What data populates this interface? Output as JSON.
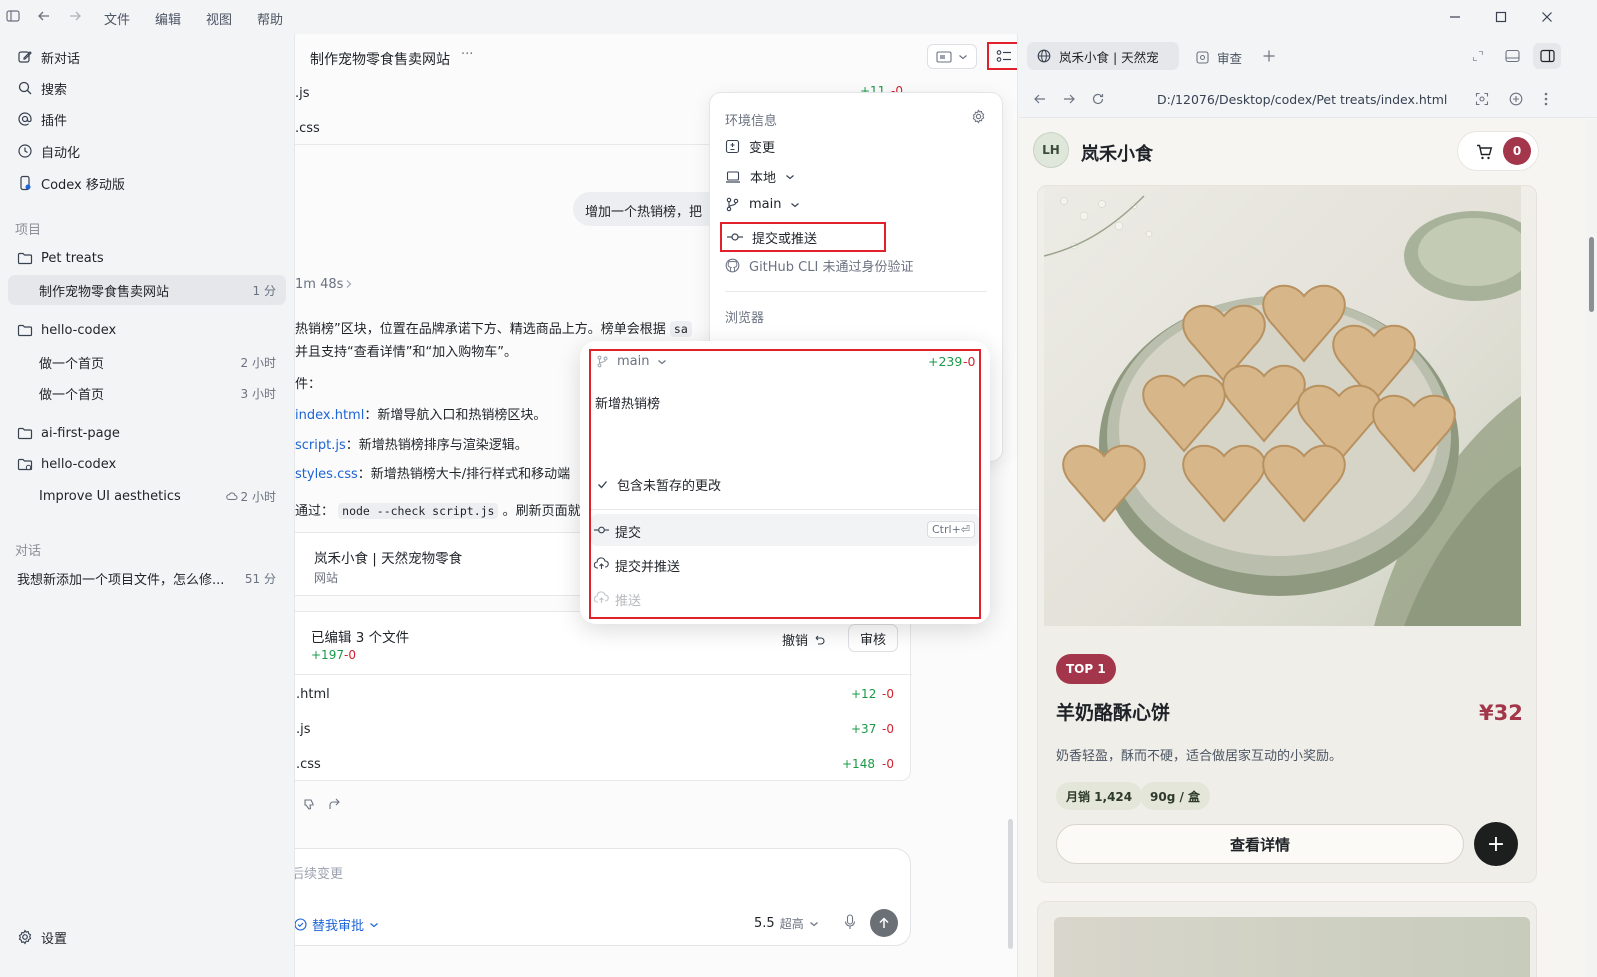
{
  "menu": [
    "文件",
    "编辑",
    "视图",
    "帮助"
  ],
  "sidebar": {
    "top_items": [
      {
        "label": "新对话",
        "icon": "edit-icon"
      },
      {
        "label": "搜索",
        "icon": "search-icon"
      },
      {
        "label": "插件",
        "icon": "at-icon"
      },
      {
        "label": "自动化",
        "icon": "clock-icon"
      },
      {
        "label": "Codex 移动版",
        "icon": "mobile-icon"
      }
    ],
    "projects_label": "项目",
    "projects": [
      {
        "name": "Pet treats",
        "threads": [
          {
            "title": "制作宠物零食售卖网站",
            "time": "1 分"
          }
        ]
      },
      {
        "name": "hello-codex",
        "threads": [
          {
            "title": "做一个首页",
            "time": "2 小时"
          },
          {
            "title": "做一个首页",
            "time": "3 小时"
          }
        ]
      },
      {
        "name": "ai-first-page",
        "threads": []
      },
      {
        "name": "hello-codex",
        "threads": [
          {
            "title": "Improve UI aesthetics",
            "time": "2 小时"
          }
        ]
      }
    ],
    "conversations_label": "对话",
    "conversations": [
      {
        "title": "我想新添加一个项目文件，怎么修...",
        "time": "51 分"
      }
    ],
    "settings_label": "设置"
  },
  "center": {
    "title": "制作宠物零食售卖网站",
    "more": "···",
    "file_js_top": ".js",
    "file_js_top_add": "+11",
    "file_js_top_del": "-0",
    "file_css_top": ".css",
    "user_message": "增加一个热销榜，把",
    "elapsed": "1m 48s",
    "reply_line1": "热销榜”区块，位置在品牌承诺下方、精选商品上方。榜单会根据",
    "reply_line1_code": "sa",
    "reply_line2": "并且支持“查看详情”和“加入购物车”。",
    "reply_line3": "件：",
    "files_summary": [
      {
        "name": "index.html",
        "desc": "：新增导航入口和热销榜区块。"
      },
      {
        "name": "script.js",
        "desc": "：新增热销榜排序与渲染逻辑。"
      },
      {
        "name": "styles.css",
        "desc": "：新增热销榜大卡/排行样式和移动端"
      }
    ],
    "check_prefix": "通过：",
    "check_code": "node --check script.js",
    "check_suffix": "。刷新页面就",
    "site_card_title": "岚禾小食 | 天然宠物零食",
    "site_card_sub": "网站",
    "edited_title": "已编辑 3 个文件",
    "edited_add": "+197",
    "edited_del": "-0",
    "undo_label": "撤销",
    "review_label": "审核",
    "edited_files": [
      {
        "name": ".html",
        "add": "+12",
        "del": "-0"
      },
      {
        "name": ".js",
        "add": "+37",
        "del": "-0"
      },
      {
        "name": ".css",
        "add": "+148",
        "del": "-0"
      }
    ],
    "input_placeholder": "后续变更",
    "approve_label": "替我审批",
    "model_label": "5.5",
    "model_level": "超高"
  },
  "env_panel": {
    "header": "环境信息",
    "items": [
      "变更",
      "本地",
      "main",
      "提交或推送",
      "GitHub CLI 未通过身份验证"
    ],
    "browser_label": "浏览器"
  },
  "commit_popup": {
    "branch": "main",
    "add": "+239",
    "del": "-0",
    "message": "新增热销榜",
    "include_unstaged": "包含未暂存的更改",
    "commit": "提交",
    "commit_shortcut": "Ctrl+⏎",
    "commit_push": "提交并推送",
    "push": "推送"
  },
  "browser": {
    "tab_title": "岚禾小食 | 天然宠",
    "tab2": "审查",
    "url": "D:/12076/Desktop/codex/Pet treats/index.html",
    "logo_initials": "LH",
    "site_name": "岚禾小食",
    "cart_count": "0",
    "badge": "TOP 1",
    "product_name": "羊奶酪酥心饼",
    "price": "¥32",
    "desc": "奶香轻盈，酥而不硬，适合做居家互动的小奖励。",
    "tag1": "月销 1,424",
    "tag2": "90g / 盒",
    "detail_btn": "查看详情",
    "add_btn": "+"
  },
  "colors": {
    "accent_red": "#e0202b",
    "brand": "#a3364a",
    "add_green": "#1a9a48",
    "del_red": "#d1242f"
  }
}
